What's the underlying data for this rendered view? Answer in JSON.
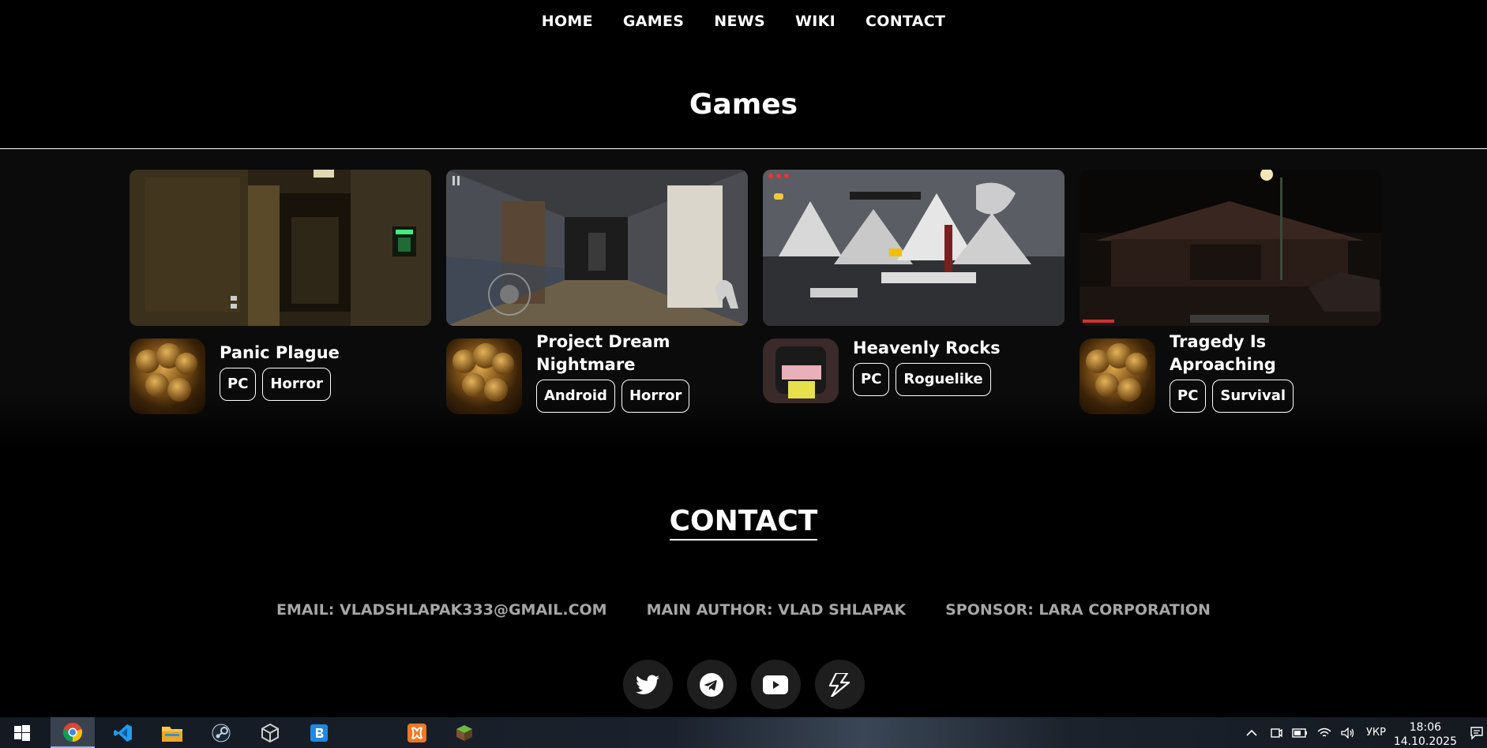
{
  "nav": {
    "items": [
      "HOME",
      "GAMES",
      "NEWS",
      "WIKI",
      "CONTACT"
    ]
  },
  "games_section": {
    "title": "Games",
    "cards": [
      {
        "title": "Panic Plague",
        "tags": [
          "PC",
          "Horror"
        ]
      },
      {
        "title": "Project Dream Nightmare",
        "tags": [
          "Android",
          "Horror"
        ]
      },
      {
        "title": "Heavenly Rocks",
        "tags": [
          "PC",
          "Roguelike"
        ]
      },
      {
        "title": "Tragedy Is Aproaching",
        "tags": [
          "PC",
          "Survival"
        ]
      }
    ]
  },
  "contact": {
    "title": "CONTACT",
    "email": "EMAIL: VLADSHLAPAK333@GMAIL.COM",
    "author": "MAIN AUTHOR: VLAD SHLAPAK",
    "sponsor": "SPONSOR: LARA CORPORATION",
    "socials": [
      "twitter-icon",
      "telegram-icon",
      "youtube-icon",
      "boosty-icon"
    ]
  },
  "taskbar": {
    "apps": [
      "windows-start-icon",
      "chrome-icon",
      "vscode-icon",
      "file-explorer-icon",
      "steam-icon",
      "unity-icon",
      "app-b-icon",
      "xampp-icon",
      "minecraft-icon"
    ],
    "language": "УКР",
    "time": "18:06",
    "date": "14.10.2025"
  }
}
